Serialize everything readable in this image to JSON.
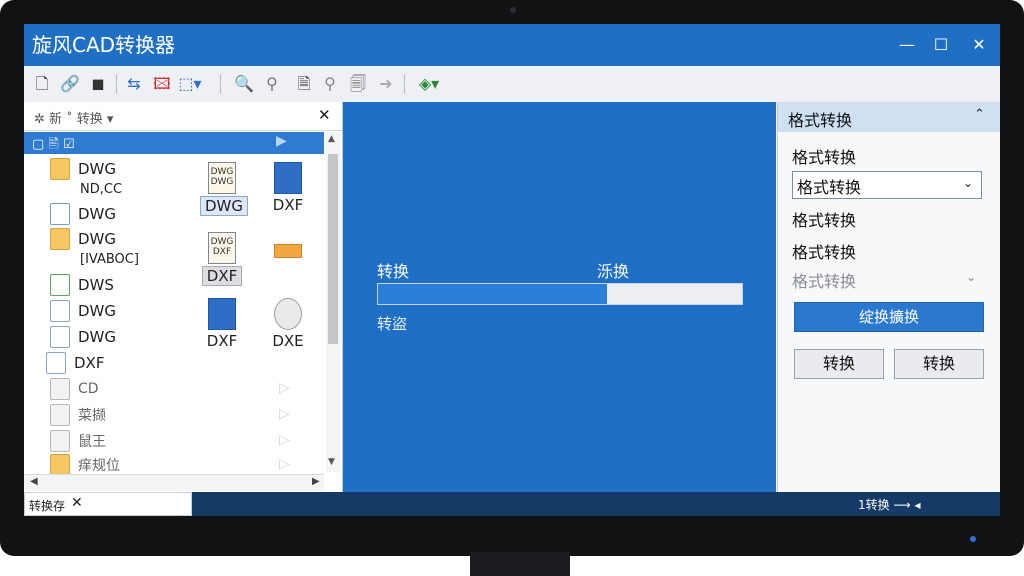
{
  "app": {
    "title": "旋风CAD转换器"
  },
  "window_controls": {
    "minimize": "—",
    "maximize": "☐",
    "close": "✕"
  },
  "toolbar": {
    "icons": [
      "new-file-icon",
      "link-icon",
      "stop-icon",
      "convert-batch-icon",
      "image-export-icon",
      "export-dropdown-icon",
      "zoom-in-icon",
      "zoom-region-icon",
      "page-icon",
      "search-icon",
      "document-icon",
      "forward-icon",
      "settings-dropdown-icon"
    ]
  },
  "left_panel": {
    "header": "✲ 新 ˚ 转换 ▾",
    "close": "✕",
    "selected_row": "▢ 🖹 ☑",
    "items": [
      {
        "label": "DWG",
        "sub": "ND,CC",
        "icon": "folder-icon"
      },
      {
        "label": "DWG",
        "icon": "image-icon"
      },
      {
        "label": "DWG",
        "sub": "[IVABOC]",
        "icon": "folder-icon"
      },
      {
        "label": "DWS",
        "icon": "green-doc-icon"
      },
      {
        "label": "DWG",
        "icon": "doc-icon"
      },
      {
        "label": "DWG",
        "icon": "doc-icon"
      },
      {
        "label": "DXF",
        "icon": "doc-icon"
      },
      {
        "label": "CD",
        "icon": "gray-doc-icon"
      },
      {
        "label": "菜撷",
        "icon": "gray-doc-icon"
      },
      {
        "label": "鼠王",
        "icon": "key-icon"
      },
      {
        "label": "痒规位",
        "icon": "folder-icon"
      }
    ],
    "tiles": [
      {
        "label": "DWG",
        "pic": "DWG DWG",
        "style": "box"
      },
      {
        "label": "DXF",
        "pic": "",
        "style": "plain"
      },
      {
        "label": "DXF",
        "pic": "DWG DXF",
        "style": "box2"
      },
      {
        "label": "",
        "pic": "",
        "style": "plain"
      },
      {
        "label": "DXF",
        "pic": "",
        "style": "plain"
      },
      {
        "label": "DXE",
        "pic": "",
        "style": "plain"
      }
    ]
  },
  "center": {
    "label_left": "转换",
    "label_right": "泺换",
    "progress": 0.63,
    "status": "转盜"
  },
  "right_panel": {
    "header": "格式转换",
    "collapse": "⌃",
    "label1": "格式转换",
    "select_value": "格式转换",
    "label2": "格式转换",
    "label3": "格式转换",
    "dim_select": "格式转换",
    "primary_button": "绽换擴换",
    "button1": "转换",
    "button2": "转换"
  },
  "statusbar": {
    "tab": "转换存 ✕",
    "tab_label": "转换存",
    "right_text": "1转换 ⟶ ◂"
  }
}
